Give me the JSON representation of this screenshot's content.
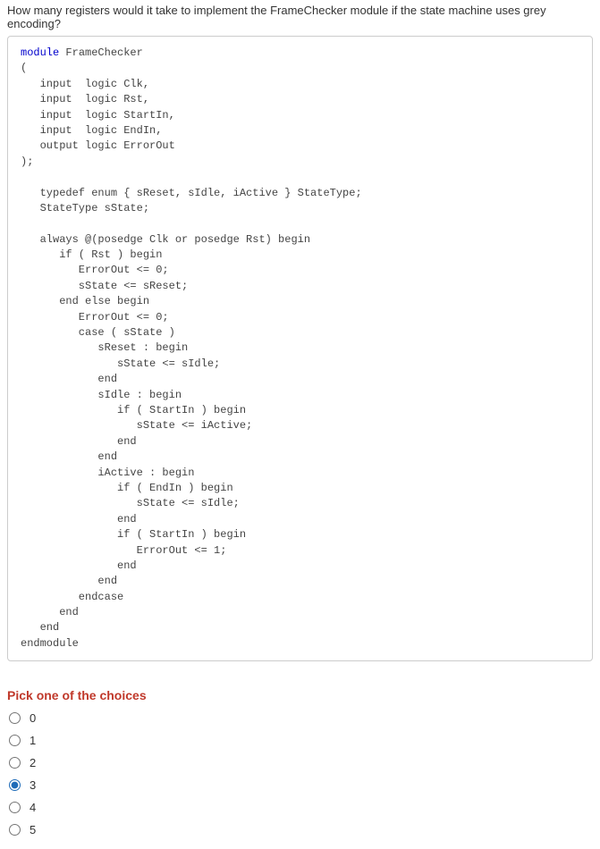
{
  "question": "How many registers would it take to implement the FrameChecker module if the state machine uses grey encoding?",
  "code": {
    "l1": "module",
    "l1b": " FrameChecker",
    "l2": "(",
    "l3a": "   input  logic ",
    "l3b": "Clk,",
    "l4a": "   input  logic ",
    "l4b": "Rst,",
    "l5a": "   input  logic ",
    "l5b": "StartIn,",
    "l6a": "   input  logic ",
    "l6b": "EndIn,",
    "l7a": "   output logic ",
    "l7b": "ErrorOut",
    "l8": ");",
    "l10": "   typedef enum { sReset, sIdle, iActive } StateType;",
    "l11": "   StateType sState;",
    "l13": "   always @(posedge Clk or posedge Rst) begin",
    "l14": "      if ( Rst ) begin",
    "l15": "         ErrorOut <= 0;",
    "l16": "         sState <= sReset;",
    "l17": "      end else begin",
    "l18": "         ErrorOut <= 0;",
    "l19": "         case ( sState )",
    "l20": "            sReset : begin",
    "l21": "               sState <= sIdle;",
    "l22": "            end",
    "l23": "            sIdle : begin",
    "l24": "               if ( StartIn ) begin",
    "l25": "                  sState <= iActive;",
    "l26": "               end",
    "l27": "            end",
    "l28": "            iActive : begin",
    "l29": "               if ( EndIn ) begin",
    "l30": "                  sState <= sIdle;",
    "l31": "               end",
    "l32": "               if ( StartIn ) begin",
    "l33": "                  ErrorOut <= 1;",
    "l34": "               end",
    "l35": "            end",
    "l36": "         endcase",
    "l37": "      end",
    "l38": "   end",
    "l39": "endmodule"
  },
  "choicesHeading": "Pick one of the choices",
  "choices": {
    "c0": "0",
    "c1": "1",
    "c2": "2",
    "c3": "3",
    "c4": "4",
    "c5": "5"
  },
  "selected": "3"
}
